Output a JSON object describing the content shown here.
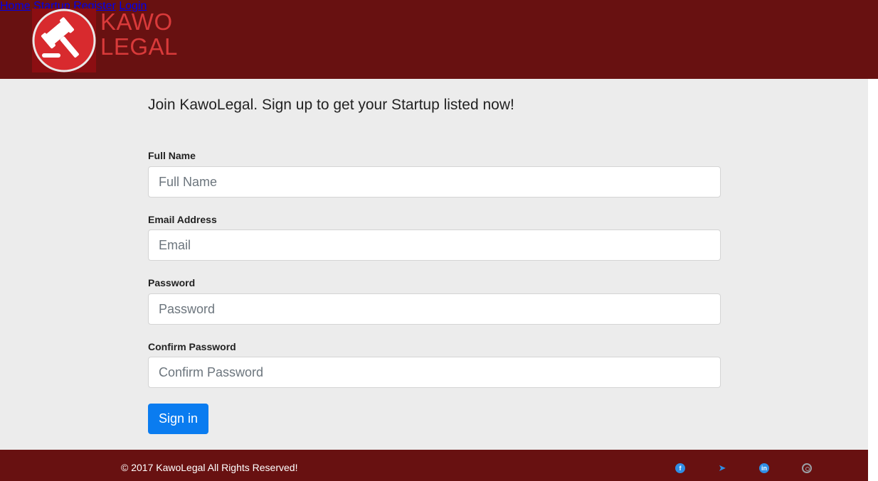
{
  "brand": {
    "line1": "KAWO",
    "line2": "LEGAL",
    "logo_icon": "gavel-icon"
  },
  "nav": {
    "items": [
      "Home",
      "Startup",
      "Register",
      "Login"
    ]
  },
  "form": {
    "heading": "Join KawoLegal. Sign up to get your Startup listed now!",
    "full_name": {
      "label": "Full Name",
      "placeholder": "Full Name",
      "value": ""
    },
    "email": {
      "label": "Email Address",
      "placeholder": "Email",
      "value": ""
    },
    "password": {
      "label": "Password",
      "placeholder": "Password",
      "value": ""
    },
    "confirm_password": {
      "label": "Confirm Password",
      "placeholder": "Confirm Password",
      "value": ""
    },
    "submit_label": "Sign in"
  },
  "footer": {
    "copyright": "© 2017 KawoLegal All Rights Reserved!",
    "social": [
      "facebook-icon",
      "twitter-icon",
      "linkedin-icon",
      "instagram-icon"
    ]
  },
  "colors": {
    "header_bg": "#681111",
    "brand_text": "#d93a3a",
    "nav_link": "#b22a26",
    "button": "#0a7cf0",
    "page_bg": "#ececec"
  }
}
